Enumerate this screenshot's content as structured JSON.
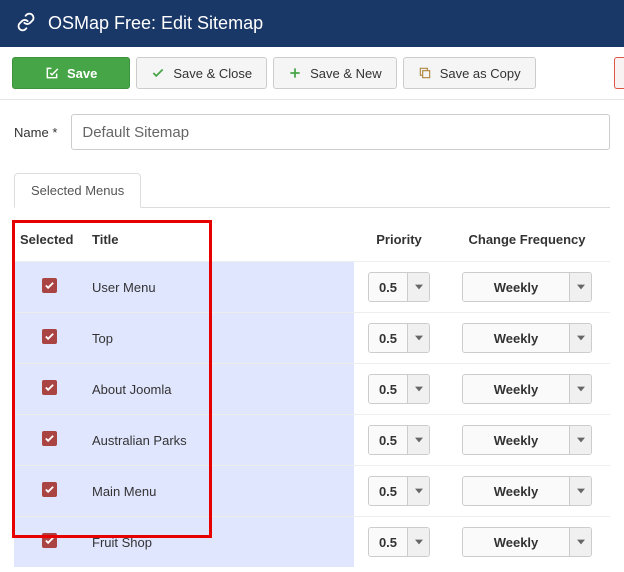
{
  "header": {
    "title": "OSMap Free: Edit Sitemap"
  },
  "toolbar": {
    "save": "Save",
    "save_close": "Save & Close",
    "save_new": "Save & New",
    "save_copy": "Save as Copy"
  },
  "form": {
    "name_label": "Name",
    "name_required": "*",
    "name_value": "Default Sitemap"
  },
  "tabs": {
    "selected_menus": "Selected Menus"
  },
  "table": {
    "headers": {
      "selected": "Selected",
      "title": "Title",
      "priority": "Priority",
      "change_frequency": "Change Frequency"
    },
    "rows": [
      {
        "selected": true,
        "title": "User Menu",
        "priority": "0.5",
        "frequency": "Weekly"
      },
      {
        "selected": true,
        "title": "Top",
        "priority": "0.5",
        "frequency": "Weekly"
      },
      {
        "selected": true,
        "title": "About Joomla",
        "priority": "0.5",
        "frequency": "Weekly"
      },
      {
        "selected": true,
        "title": "Australian Parks",
        "priority": "0.5",
        "frequency": "Weekly"
      },
      {
        "selected": true,
        "title": "Main Menu",
        "priority": "0.5",
        "frequency": "Weekly"
      },
      {
        "selected": true,
        "title": "Fruit Shop",
        "priority": "0.5",
        "frequency": "Weekly"
      }
    ]
  }
}
